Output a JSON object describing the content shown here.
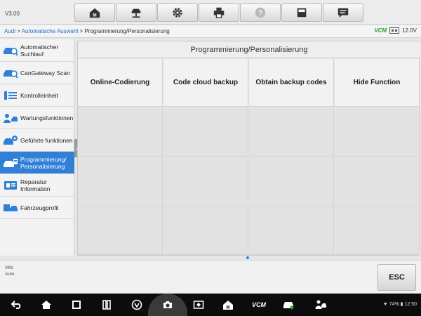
{
  "toolbar": {
    "version": "V3.00"
  },
  "breadcrumb": {
    "brand": "Audi",
    "sep1": " > ",
    "auto_select": "Automatische Auswahl",
    "sep2": " > ",
    "current": "Programmierung/Personalisierung"
  },
  "status": {
    "vcm": "VCM",
    "voltage": "12.0V"
  },
  "sidebar": {
    "items": [
      {
        "label": "Automatischer Suchlauf"
      },
      {
        "label": "CanGateway Scan"
      },
      {
        "label": "Kontrolleinheit"
      },
      {
        "label": "Wartungsfunktionen"
      },
      {
        "label": "Geführte funktionen"
      },
      {
        "label": "Programmierung/ Personalisierung"
      },
      {
        "label": "Reparatur Information"
      },
      {
        "label": "Fahrzeugprofil"
      }
    ]
  },
  "main": {
    "title": "Programmierung/Personalisierung",
    "functions": [
      {
        "label": "Online-Codierung"
      },
      {
        "label": "Code cloud backup"
      },
      {
        "label": "Obtain backup codes"
      },
      {
        "label": "Hide Function"
      }
    ]
  },
  "info": {
    "vin_label": "VIN:",
    "vehicle": "Auto",
    "esc_label": "ESC"
  },
  "nav": {
    "vcm_label": "VCM",
    "battery": "74%",
    "time": "12:50"
  },
  "colors": {
    "accent": "#2f80d6",
    "vcm_green": "#2a9b2a"
  }
}
